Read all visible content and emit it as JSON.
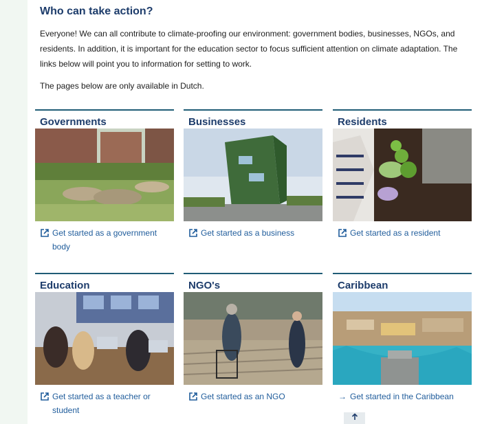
{
  "section": {
    "heading": "Who can take action?",
    "intro": "Everyone! We can all contribute to climate-proofing our environment: government bodies, businesses, NGOs, and residents. In addition, it is important for the education sector to focus sufficient attention on climate adaptation. The links below will point you to information for setting to work.",
    "note": "The pages below are only available in Dutch."
  },
  "cards": [
    {
      "title": "Governments",
      "link": "Get started as a government body",
      "icon": "external-link-icon"
    },
    {
      "title": "Businesses",
      "link": "Get started as a business",
      "icon": "external-link-icon"
    },
    {
      "title": "Residents",
      "link": "Get started as a resident",
      "icon": "external-link-icon"
    },
    {
      "title": "Education",
      "link": "Get started as a teacher or student",
      "icon": "external-link-icon"
    },
    {
      "title": "NGO's",
      "link": "Get started as an NGO",
      "icon": "external-link-icon"
    },
    {
      "title": "Caribbean",
      "link": "Get started in the Caribbean",
      "icon": "arrow-right-icon"
    }
  ],
  "back_to_top": {
    "icon": "arrow-up-icon"
  },
  "colors": {
    "heading": "#1d3c6b",
    "rule": "#1f5c75",
    "link": "#1f5c9b",
    "background": "#f1f7f2"
  }
}
